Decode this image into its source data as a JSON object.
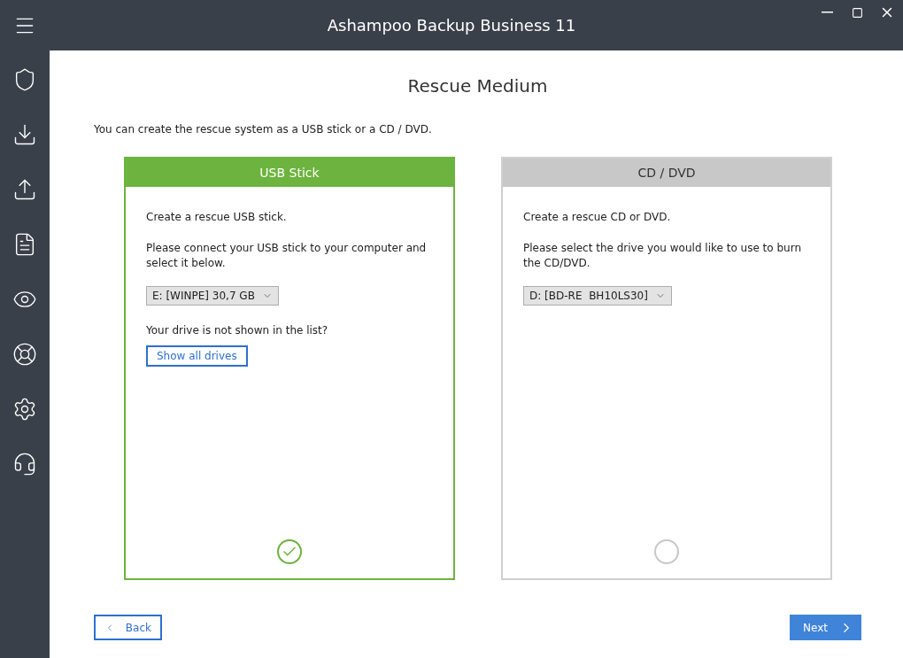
{
  "window": {
    "title": "Ashampoo Backup Business 11"
  },
  "page": {
    "heading": "Rescue Medium",
    "intro": "You can create the rescue system as a USB stick or a CD / DVD."
  },
  "options": [
    {
      "title": "USB Stick",
      "selected": true,
      "description": "Create a rescue USB stick.",
      "instruction": "Please connect your USB stick to your computer and select it below.",
      "drive": "E: [WINPE] 30,7 GB",
      "note": "Your drive is not shown in the list?",
      "button": "Show all drives"
    },
    {
      "title": "CD / DVD",
      "selected": false,
      "description": "Create a rescue CD or DVD.",
      "instruction": "Please select the drive you would like to use to burn the CD/DVD.",
      "drive": "D: [BD-RE  BH10LS30]"
    }
  ],
  "footer": {
    "back": "Back",
    "next": "Next"
  }
}
